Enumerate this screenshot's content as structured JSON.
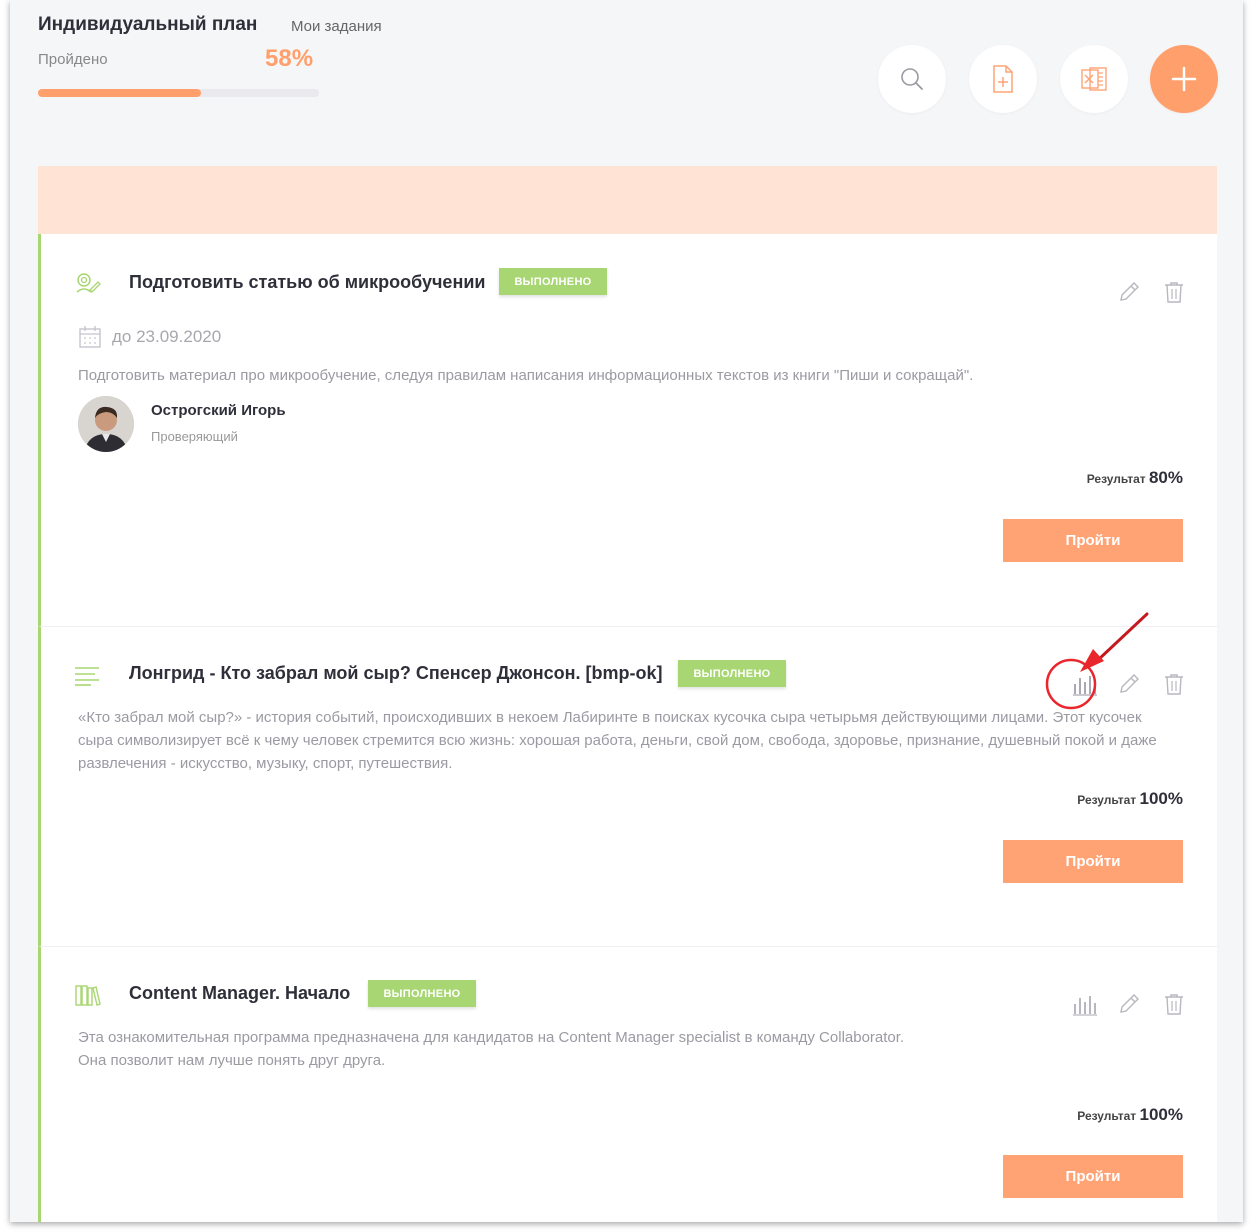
{
  "header": {
    "title": "Индивидуальный план",
    "subtitle": "Мои задания",
    "progress_label": "Пройдено",
    "progress_value": "58%",
    "progress_fraction": 0.58
  },
  "toolbar": {
    "buttons": [
      "search-icon",
      "add-file-icon",
      "excel-icon",
      "plus-icon"
    ],
    "accent": "#ff9f6b"
  },
  "tasks": [
    {
      "title": "Подготовить статью об микрообучении",
      "status": "выполнено",
      "due": "до 23.09.2020",
      "description": "Подготовить материал про микрообучение, следуя правилам написания информационных текстов из книги \"Пиши и сокращай\".",
      "reviewer_name": "Острогский Игорь",
      "reviewer_role": "Проверяющий",
      "result_label": "Результат",
      "result_value": "80%",
      "button": "Пройти",
      "icon": "task-icon"
    },
    {
      "title": "Лонгрид - Кто забрал мой сыр? Спенсер Джонсон. [bmp-ok]",
      "status": "выполнено",
      "description": "«Кто забрал мой сыр?» - история событий, происходивших в некоем Лабиринте в поисках кусочка сыра четырьмя действующими лицами. Этот кусочек сыра символизирует всё к чему человек стремится всю жизнь: хорошая работа, деньги, свой дом, свобода, здоровье, признание, душевный покой и даже развлечения - искусство, музыку, спорт, путешествия.",
      "result_label": "Результат",
      "result_value": "100%",
      "button": "Пройти",
      "icon": "text-lines-icon"
    },
    {
      "title": "Content Manager. Начало",
      "status": "выполнено",
      "description_line1": "Эта ознакомительная программа предназначена для кандидатов на Content Manager specialist в команду Collaborator.",
      "description_line2": "Она позволит нам лучше понять друг друга.",
      "result_label": "Результат",
      "result_value": "100%",
      "button": "Пройти",
      "icon": "books-icon"
    }
  ],
  "colors": {
    "status_green": "#a8d672",
    "banner": "#ffe3d5",
    "button": "#ffa374",
    "annotation_red": "#e8262c"
  }
}
